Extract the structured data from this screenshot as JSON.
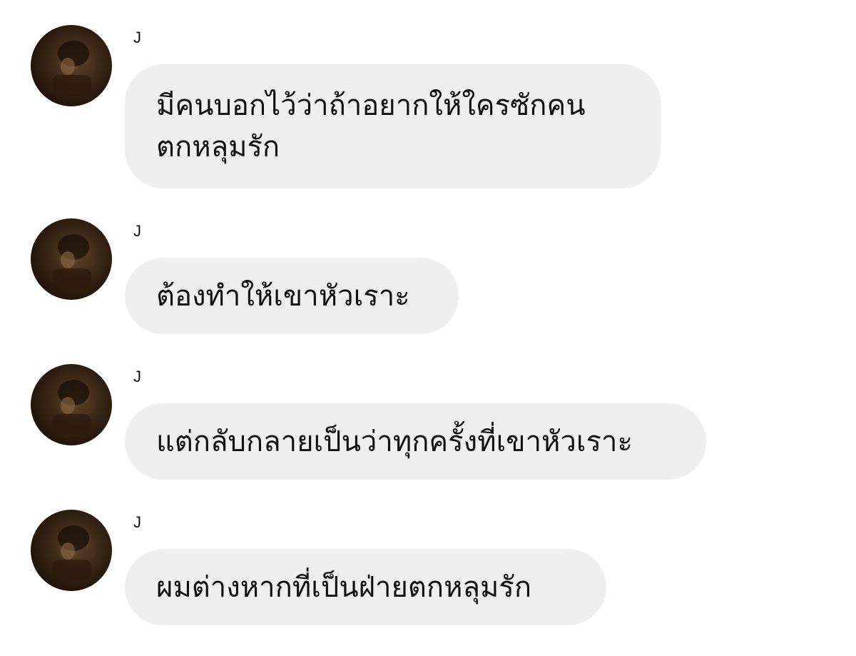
{
  "messages": [
    {
      "sender": "J",
      "text": "มีคนบอกไว้ว่าถ้าอยากให้ใครซักคน\nตกหลุมรัก"
    },
    {
      "sender": "J",
      "text": "ต้องทำให้เขาหัวเราะ"
    },
    {
      "sender": "J",
      "text": "แต่กลับกลายเป็นว่าทุกครั้งที่เขาหัวเราะ"
    },
    {
      "sender": "J",
      "text": "ผมต่างหากที่เป็นฝ่ายตกหลุมรัก"
    }
  ],
  "colors": {
    "bubble": "#efefef",
    "text": "#111111",
    "background": "#ffffff"
  },
  "icons": {
    "avatar": "avatar-photo"
  }
}
